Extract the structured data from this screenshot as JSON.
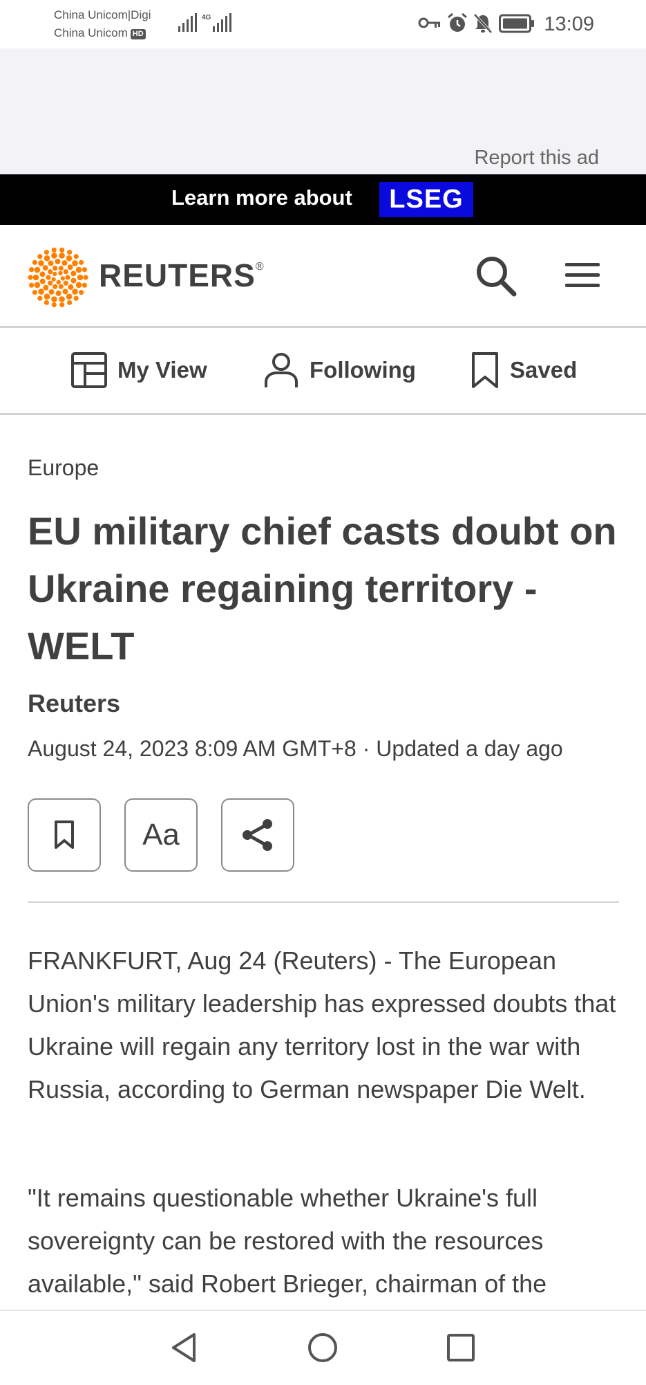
{
  "status_bar": {
    "carrier_1": "China Unicom|Digi",
    "carrier_2": "China Unicom",
    "hd_badge": "HD",
    "network": "4G",
    "time": "13:09"
  },
  "ad": {
    "report_label": "Report this ad",
    "banner_text": "Learn more about",
    "banner_brand": "LSEG",
    "brand_color": "#0a0adf"
  },
  "header": {
    "logo_text": "REUTERS",
    "logo_reg": "®",
    "accent_color": "#ff8000",
    "icons": [
      "reuters-logo-icon",
      "search-icon",
      "menu-icon"
    ]
  },
  "subnav": {
    "items": [
      {
        "label": "My View",
        "icon": "layout-icon"
      },
      {
        "label": "Following",
        "icon": "person-icon"
      },
      {
        "label": "Saved",
        "icon": "bookmark-icon"
      }
    ]
  },
  "article": {
    "section": "Europe",
    "headline": "EU military chief casts doubt on Ukraine regaining territory - WELT",
    "byline": "Reuters",
    "date": "August 24, 2023 8:09 AM GMT+8 · Updated a day ago",
    "tools": {
      "save_icon": "bookmark-icon",
      "font_size_label": "Aa",
      "share_icon": "share-icon"
    },
    "paragraphs": [
      "FRANKFURT, Aug 24 (Reuters) - The European Union's military leadership has expressed doubts that Ukraine will regain any territory lost in the war with Russia, according to German newspaper Die Welt.",
      "\"It remains questionable whether Ukraine's full sovereignty can be restored with the resources available,\" said Robert Brieger, chairman of the"
    ]
  },
  "nav_bar": {
    "icons": [
      "back-icon",
      "home-icon",
      "recents-icon"
    ]
  }
}
